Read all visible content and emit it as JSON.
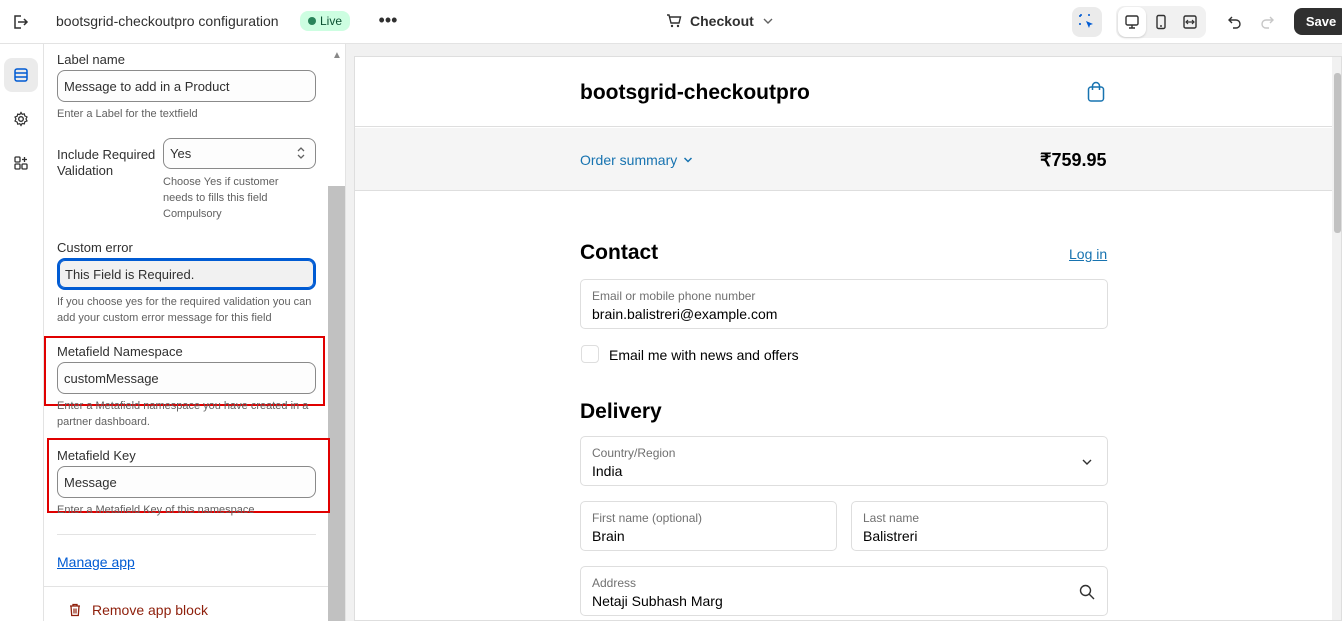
{
  "topbar": {
    "title": "bootsgrid-checkoutpro configuration",
    "status_badge": "Live",
    "more_label": "•••",
    "page_selector": "Checkout",
    "save_label": "Save"
  },
  "panel": {
    "label_name": {
      "label": "Label name",
      "value": "Message to add in a Product",
      "help": "Enter a Label for the textfield"
    },
    "required_validation": {
      "label": "Include Required Validation",
      "value": "Yes",
      "help": "Choose Yes if customer needs to fills this field Compulsory"
    },
    "custom_error": {
      "label": "Custom error",
      "value": "This Field is Required.",
      "help": "If you choose yes for the required validation you can add your custom error message for this field"
    },
    "metafield_namespace": {
      "label": "Metafield Namespace",
      "value": "customMessage",
      "help": "Enter a Metafield namespace you have created in a partner dashboard."
    },
    "metafield_key": {
      "label": "Metafield Key",
      "value": "Message",
      "help": "Enter a Metafield Key of this namespace"
    },
    "manage_app": "Manage app",
    "remove_block": "Remove app block"
  },
  "preview": {
    "store_name": "bootsgrid-checkoutpro",
    "order_summary": "Order summary",
    "total": "₹759.95",
    "contact": {
      "heading": "Contact",
      "login": "Log in",
      "email_label": "Email or mobile phone number",
      "email_value": "brain.balistreri@example.com",
      "newsletter": "Email me with news and offers"
    },
    "delivery": {
      "heading": "Delivery",
      "country_label": "Country/Region",
      "country_value": "India",
      "first_name_label": "First name (optional)",
      "first_name_value": "Brain",
      "last_name_label": "Last name",
      "last_name_value": "Balistreri",
      "address_label": "Address",
      "address_value": "Netaji Subhash Marg"
    }
  },
  "colors": {
    "accent": "#005bd3",
    "highlight": "#e00000",
    "live_badge": "#cdfee1",
    "link": "#1773b0"
  }
}
